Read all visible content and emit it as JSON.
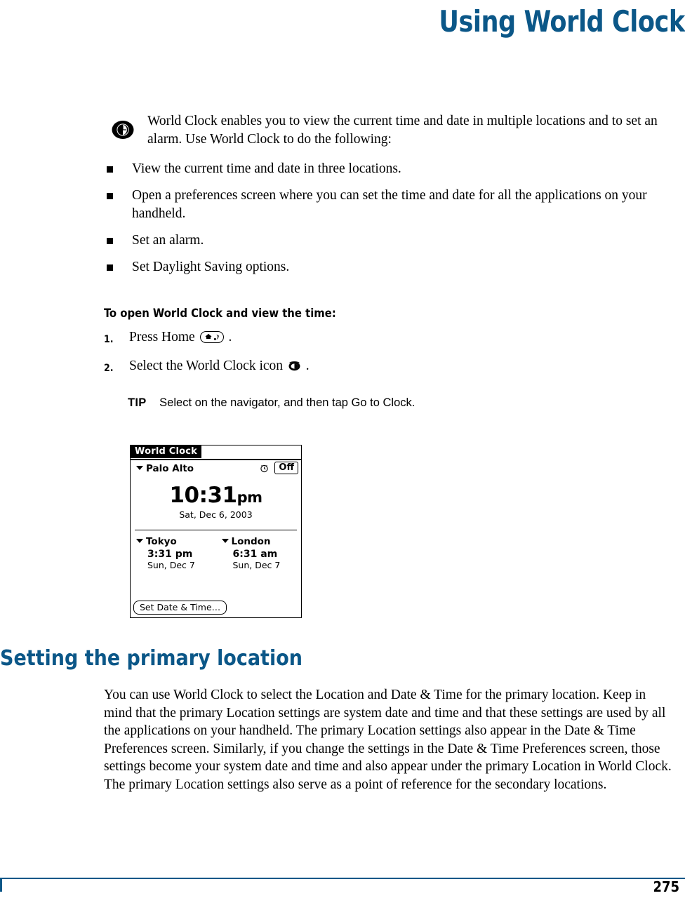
{
  "header": {
    "title": "Using World Clock"
  },
  "intro": {
    "icon": "world-clock-globe-icon",
    "text": "World Clock enables you to view the current time and date in multiple locations and to set an alarm. Use World Clock to do the following:"
  },
  "bullets": [
    "View the current time and date in three locations.",
    "Open a preferences screen where you can set the time and date for all the applications on your handheld.",
    "Set an alarm.",
    "Set Daylight Saving options."
  ],
  "procedure": {
    "heading": "To open World Clock and view the time:",
    "steps": [
      {
        "num": "1.",
        "before": "Press Home ",
        "icon": "home-key-icon",
        "after": "."
      },
      {
        "num": "2.",
        "before": "Select the World Clock icon ",
        "icon": "world-clock-app-icon",
        "after": "."
      }
    ],
    "tip": {
      "label": "TIP",
      "text": "Select on the navigator, and then tap Go to Clock."
    }
  },
  "screenshot": {
    "app_title": "World Clock",
    "primary": {
      "city": "Palo Alto",
      "alarm_icon": "alarm-clock-icon",
      "alarm_state": "Off",
      "time": "10:31",
      "ampm": "pm",
      "date": "Sat, Dec 6, 2003"
    },
    "secondary": [
      {
        "city": "Tokyo",
        "time": "3:31 pm",
        "date": "Sun, Dec 7"
      },
      {
        "city": "London",
        "time": "6:31 am",
        "date": "Sun, Dec 7"
      }
    ],
    "button": "Set Date & Time…"
  },
  "section": {
    "heading": "Setting the primary location",
    "paragraph": "You can use World Clock to select the Location and Date & Time for the primary location. Keep in mind that the primary Location settings are system date and time and that these settings are used by all the applications on your handheld. The primary Location settings also appear in the Date & Time Preferences screen. Similarly, if you change the settings in the Date & Time Preferences screen, those settings become your system date and time and also appear under the primary Location in World Clock. The primary Location settings also serve as a point of reference for the secondary locations."
  },
  "footer": {
    "page_number": "275",
    "rule_color": "#0B5788"
  }
}
